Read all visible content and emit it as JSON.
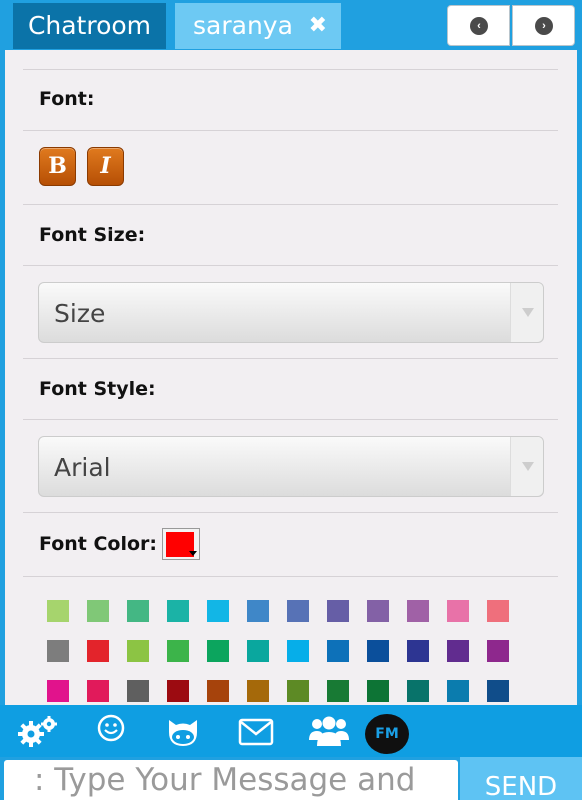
{
  "tabs": {
    "chatroom_label": "Chatroom",
    "user_label": "saranya",
    "close_glyph": "✖"
  },
  "nav": {
    "prev_glyph": "‹",
    "next_glyph": "›"
  },
  "settings": {
    "font_label": "Font:",
    "bold_label": "B",
    "italic_label": "I",
    "font_size_label": "Font Size:",
    "font_size_value": "Size",
    "font_style_label": "Font Style:",
    "font_style_value": "Arial",
    "font_color_label": "Font Color:",
    "font_color_value": "#ff0000"
  },
  "palette": [
    [
      "#a6d46d",
      "#80c877",
      "#44b784",
      "#1bb3a6",
      "#12b6e6",
      "#3f87c8",
      "#5772b6",
      "#665ea6",
      "#8361a6",
      "#a061a6",
      "#e872a8",
      "#ef6f7c"
    ],
    [
      "#7d7d7d",
      "#e3242b",
      "#8cc444",
      "#3cb44a",
      "#0ca55e",
      "#0aa79e",
      "#06aee9",
      "#0d71b9",
      "#0b4f9b",
      "#2d3592",
      "#612c8f",
      "#8e288d"
    ],
    [
      "#e1138c",
      "#e11a5b",
      "#5f5f5f",
      "#9c0b11",
      "#a6430c",
      "#a5690a",
      "#5d8a25",
      "#187a34",
      "#0d7435",
      "#08736a",
      "#0b7cae",
      "#104d8a"
    ]
  ],
  "toolbar": {
    "icons": [
      "gear-icon",
      "smiley-icon",
      "octocat-icon",
      "mail-icon",
      "users-icon"
    ],
    "fm_label": "FM"
  },
  "composer": {
    "placeholder": ": Type Your Message and",
    "send_label": "SEND"
  }
}
